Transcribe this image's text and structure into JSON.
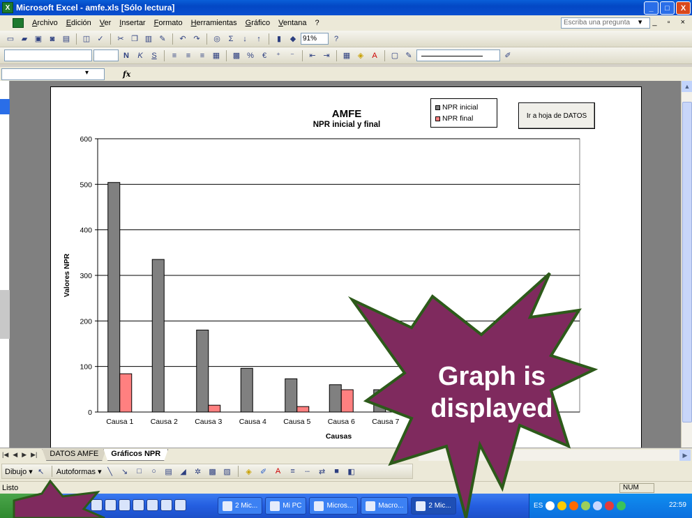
{
  "window": {
    "title": "Microsoft Excel - amfe.xls  [Sólo lectura]",
    "min_glyph": "_",
    "max_glyph": "□",
    "close_glyph": "X"
  },
  "menu": {
    "items": [
      "Archivo",
      "Edición",
      "Ver",
      "Insertar",
      "Formato",
      "Herramientas",
      "Gráfico",
      "Ventana",
      "?"
    ],
    "ask_placeholder": "Escriba una pregunta",
    "right_controls": "▾ _ ▫ ×"
  },
  "toolbar": {
    "zoom": "91%",
    "bold_glyph": "N",
    "italic_glyph": "K",
    "underline_glyph": "S",
    "euro_glyph": "€",
    "percent_glyph": "%",
    "sum_glyph": "Σ"
  },
  "formula_bar": {
    "fx_label": "fx"
  },
  "chart_data": {
    "type": "bar",
    "title": "AMFE",
    "subtitle": "NPR inicial y final",
    "xlabel": "Causas",
    "ylabel": "Valores NPR",
    "ylim": [
      0,
      600
    ],
    "yticks": [
      0,
      100,
      200,
      300,
      400,
      500,
      600
    ],
    "categories": [
      "Causa 1",
      "Causa 2",
      "Causa 3",
      "Causa 4",
      "Causa 5",
      "Causa 6",
      "Causa 7"
    ],
    "series": [
      {
        "name": "NPR inicial",
        "color": "#808080",
        "values": [
          504,
          335,
          180,
          96,
          73,
          60,
          49
        ]
      },
      {
        "name": "NPR final",
        "color": "#ff8080",
        "values": [
          84,
          0,
          15,
          0,
          12,
          49,
          0
        ]
      }
    ],
    "grid": true,
    "legend_position": "top-right"
  },
  "chart_button": "Ir a hoja de DATOS",
  "sheet_tabs": {
    "nav": [
      "|◀",
      "◀",
      "▶",
      "▶|"
    ],
    "tabs": [
      "DATOS AMFE",
      "Gráficos NPR"
    ],
    "active": "Gráficos NPR"
  },
  "draw_toolbar": {
    "dibujo": "Dibujo ▾",
    "autoformas": "Autoformas ▾"
  },
  "status": {
    "text": "Listo",
    "num": "NUM"
  },
  "taskbar": {
    "items": [
      "2 Mic...",
      "Mi PC",
      "Micros...",
      "Macro...",
      "2 Mic..."
    ],
    "lang": "ES",
    "clock": "22:59"
  },
  "callout": {
    "line1": "Graph is",
    "line2": "displayed",
    "fill": "#7f2a5e",
    "stroke": "#2d5a1a"
  }
}
